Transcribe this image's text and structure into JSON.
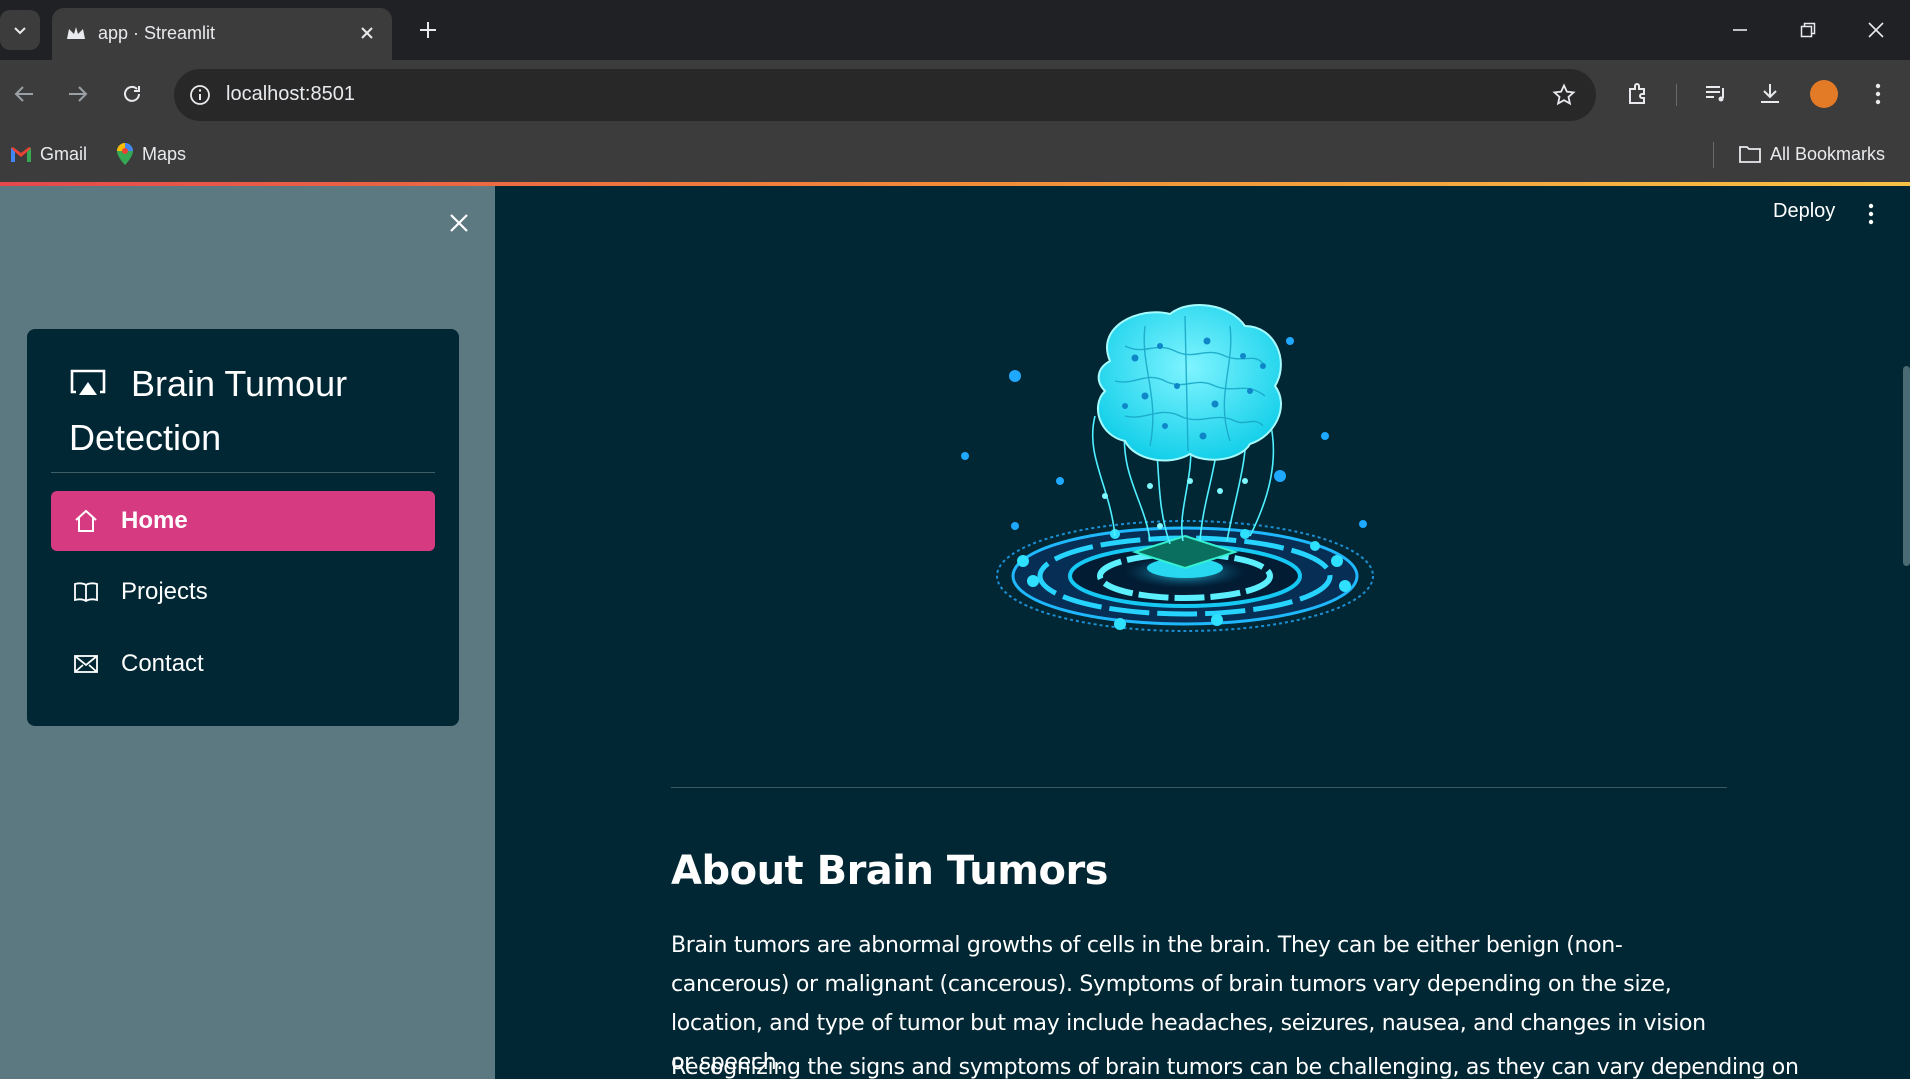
{
  "browser": {
    "tab_title": "app · Streamlit",
    "url": "localhost:8501",
    "bookmarks": [
      {
        "label": "Gmail",
        "icon": "gmail-icon"
      },
      {
        "label": "Maps",
        "icon": "maps-icon"
      }
    ],
    "all_bookmarks_label": "All Bookmarks"
  },
  "sidebar": {
    "title": "Brain Tumour Detection",
    "title_icon": "cast-icon",
    "items": [
      {
        "label": "Home",
        "icon": "house-icon",
        "active": true
      },
      {
        "label": "Projects",
        "icon": "book-icon",
        "active": false
      },
      {
        "label": "Contact",
        "icon": "envelope-icon",
        "active": false
      }
    ]
  },
  "header": {
    "deploy_label": "Deploy"
  },
  "content": {
    "heading": "About Brain Tumors",
    "paragraph": "Brain tumors are abnormal growths of cells in the brain. They can be either benign (non-cancerous) or malignant (cancerous). Symptoms of brain tumors vary depending on the size, location, and type of tumor but may include headaches, seizures, nausea, and changes in vision or speech.",
    "paragraph_2": "Recognizing the signs and symptoms of brain tumors can be challenging, as they can vary depending on"
  },
  "colors": {
    "sidebar_bg": "#5c7880",
    "main_bg": "#002733",
    "menu_card_bg": "#002733",
    "active_item": "#d63a81",
    "accent_gradient": [
      "#e5484d",
      "#f28b38",
      "#f6c244"
    ]
  }
}
